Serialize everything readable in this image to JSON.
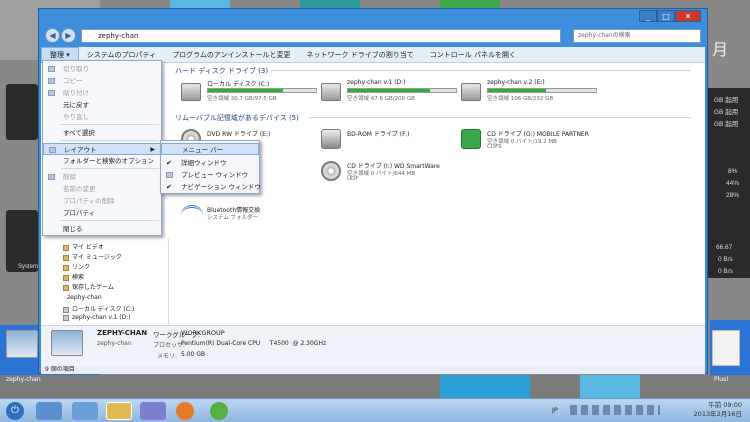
{
  "window": {
    "address": "zephy-chan",
    "search_placeholder": "zephy-chanの検索",
    "buttons": {
      "min": "_",
      "max": "□",
      "close": "✕"
    }
  },
  "toolbar": {
    "organize": "整理 ▾",
    "system_properties": "システムのプロパティ",
    "uninstall": "プログラムのアンインストールと変更",
    "map_drive": "ネットワーク ドライブの割り当て",
    "control_panel": "コントロール パネルを開く"
  },
  "groups": {
    "hdd": "ハード ディスク ドライブ (3)",
    "removable": "リムーバブル記憶域があるデバイス (5)"
  },
  "drives": [
    {
      "name": "ローカル ディスク (C:)",
      "free": "空き領域 30.7 GB/97.5 GB",
      "used_fraction": 0.69
    },
    {
      "name": "zephy-chan v.1 (D:)",
      "free": "空き領域 47.6 GB/200 GB",
      "used_fraction": 0.76
    },
    {
      "name": "zephy-chan v.2 (E:)",
      "free": "空き領域 106 GB/232 GB",
      "used_fraction": 0.54
    }
  ],
  "devices": [
    {
      "name": "DVD RW ドライブ (E:)",
      "sub": ""
    },
    {
      "name": "BD-ROM ドライブ (F:)",
      "sub": ""
    },
    {
      "name": "CD ドライブ (G:) MOBILE PARTNER",
      "sub": "空き領域 0 バイト/19.2 MB",
      "sub2": "CDFS"
    },
    {
      "name": "CD ドライブ (I:) WD SmartWare",
      "sub": "空き領域 0 バイト/644 MB",
      "sub2": "UDF"
    },
    {
      "name": "Bluetooth情報交換",
      "sub": "システム フォルダー"
    }
  ],
  "organize_menu": {
    "items": [
      "切り取り",
      "コピー",
      "貼り付け",
      "元に戻す",
      "やり直し",
      "すべて選択",
      "レイアウト",
      "フォルダーと検索のオプション",
      "削除",
      "名前の変更",
      "プロパティの削除",
      "プロパティ",
      "閉じる"
    ]
  },
  "layout_menu": {
    "items": [
      "メニュー バー",
      "詳細ウィンドウ",
      "プレビュー ウィンドウ",
      "ナビゲーション ウィンドウ"
    ]
  },
  "nav": {
    "items": [
      "マイ ビデオ",
      "マイ ミュージック",
      "リンク",
      "検索",
      "保存したゲーム",
      "zephy-chan",
      "ローカル ディスク (C:)",
      "zephy-chan v.1 (D:)"
    ]
  },
  "details": {
    "computer_name": "ZEPHY-CHAN",
    "workgroup_label": "ワークグループ:",
    "workgroup": "WORKGROUP",
    "subtitle": "zephy-chan",
    "processor_label": "プロセッサ:",
    "processor": "Pentium(R) Dual-Core CPU     T4500  @ 2.30GHz",
    "memory_label": "メモリ:",
    "memory": "5.00 GB"
  },
  "status": {
    "items": "9 個の項目"
  },
  "desktop": {
    "icon_label": "zephy-chan",
    "icon2_label": "System",
    "plus_label": "Plus!",
    "widget_rows": [
      "GB 起用",
      "GB 起用",
      "GB 起用",
      "8%",
      "44%",
      "28%",
      "66.67",
      "0 B/s",
      "0 B/s"
    ],
    "top_right": "月"
  },
  "taskbar": {
    "lang": "JP",
    "time": "午前 09:00",
    "date": "2013年2月16日"
  },
  "colors": {
    "window_frame": "#3d8fdd",
    "drive_fill": "#2eae3a",
    "menu_highlight": "#cfe2f7"
  }
}
